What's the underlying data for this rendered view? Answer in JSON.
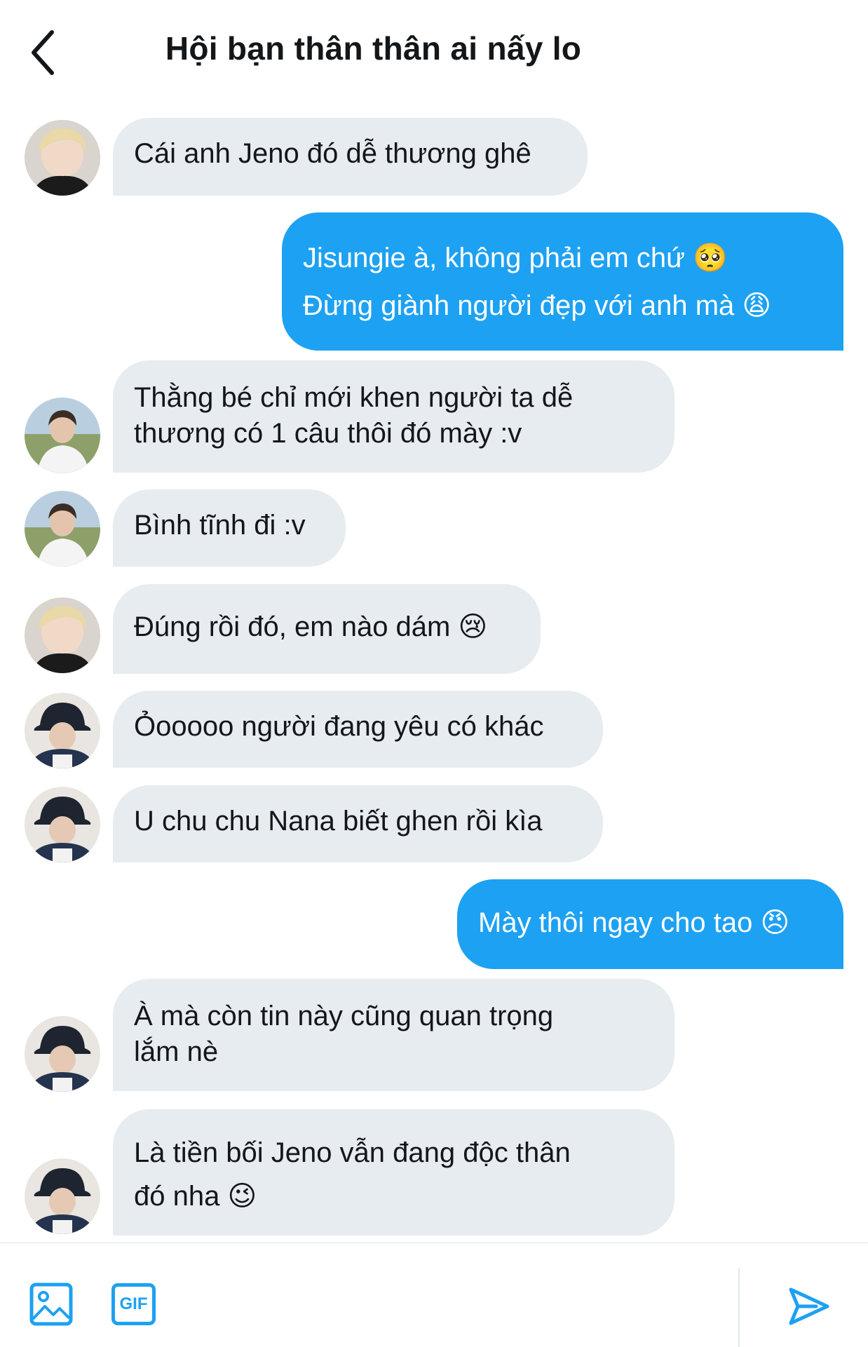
{
  "header": {
    "title": "Hội bạn thân thân ai nấy lo",
    "back_icon": "chevron-left-icon"
  },
  "colors": {
    "accent": "#1da1f2",
    "received_bubble": "#e6ecf0",
    "text": "#14171a"
  },
  "messages": [
    {
      "side": "received",
      "avatar": "avatar-blonde",
      "lines": [
        "Cái anh Jeno đó dễ thương ghê"
      ]
    },
    {
      "side": "sent",
      "lines": [
        "Jisungie à, không phải em chứ 🥺",
        "Đừng giành người đẹp với anh mà 😩"
      ]
    },
    {
      "side": "received",
      "avatar": "avatar-outdoor",
      "lines": [
        "Thằng bé chỉ mới khen người ta dễ",
        "thương có 1 câu thôi đó mày :v"
      ]
    },
    {
      "side": "received",
      "avatar": "avatar-outdoor",
      "lines": [
        "Bình tĩnh đi :v"
      ]
    },
    {
      "side": "received",
      "avatar": "avatar-blonde",
      "lines": [
        "Đúng rồi đó, em nào dám 😢"
      ]
    },
    {
      "side": "received",
      "avatar": "avatar-bucket-hat",
      "lines": [
        "Ỏooooo người đang yêu có khác"
      ]
    },
    {
      "side": "received",
      "avatar": "avatar-bucket-hat",
      "lines": [
        "U chu chu Nana biết ghen rồi kìa"
      ]
    },
    {
      "side": "sent",
      "lines": [
        "Mày thôi ngay cho tao 😠"
      ]
    },
    {
      "side": "received",
      "avatar": "avatar-bucket-hat",
      "lines": [
        "À mà còn tin này cũng quan trọng",
        "lắm nè"
      ]
    },
    {
      "side": "received",
      "avatar": "avatar-bucket-hat",
      "lines": [
        "Là tiền bối Jeno vẫn đang độc thân",
        "đó nha 😉"
      ]
    }
  ],
  "compose": {
    "image_icon": "image-icon",
    "gif_label": "GIF",
    "send_icon": "send-icon"
  }
}
